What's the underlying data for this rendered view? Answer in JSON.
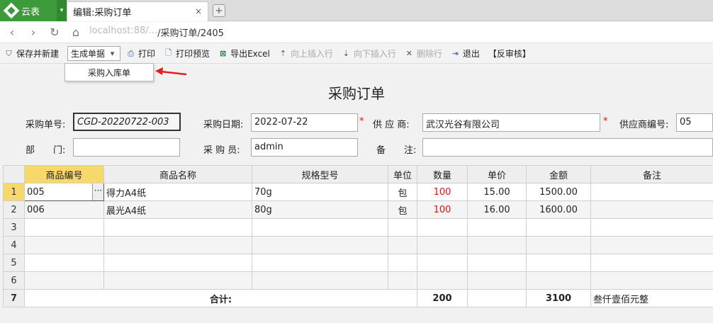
{
  "app": {
    "name": "云表"
  },
  "tab": {
    "title": "编辑:采购订单",
    "close": "×",
    "new_tab": "+"
  },
  "address": {
    "host": "localhost:88/...",
    "path": "/采购订单/2405"
  },
  "toolbar": {
    "save_new": "保存并新建",
    "generate": "生成单据",
    "print": "打印",
    "print_preview": "打印预览",
    "export_excel": "导出Excel",
    "insert_above": "向上插入行",
    "insert_below": "向下插入行",
    "delete_row": "删除行",
    "exit": "退出",
    "unreview": "【反审核】"
  },
  "menu": {
    "items": [
      "采购入库单"
    ]
  },
  "form": {
    "title": "采购订单",
    "order_no_label": "采购单号:",
    "order_no": "CGD-20220722-003",
    "date_label": "采购日期:",
    "date": "2022-07-22",
    "supplier_label": "供 应 商:",
    "supplier": "武汉光谷有限公司",
    "supplier_code_label": "供应商编号:",
    "supplier_code": "05",
    "dept_label": "部　　门:",
    "dept": "",
    "buyer_label": "采 购 员:",
    "buyer": "admin",
    "remark_label": "备　　注:",
    "remark": "",
    "required_mark": "*"
  },
  "grid": {
    "columns": [
      "商品编号",
      "商品名称",
      "规格型号",
      "单位",
      "数量",
      "单价",
      "金额",
      "备注"
    ],
    "rows": [
      {
        "n": "1",
        "code": "005",
        "name": "得力A4纸",
        "spec": "70g",
        "unit": "包",
        "qty": "100",
        "price": "15.00",
        "amount": "1500.00",
        "note": ""
      },
      {
        "n": "2",
        "code": "006",
        "name": "晨光A4纸",
        "spec": "80g",
        "unit": "包",
        "qty": "100",
        "price": "16.00",
        "amount": "1600.00",
        "note": ""
      }
    ],
    "empty_rows": [
      "3",
      "4",
      "5",
      "6"
    ],
    "total": {
      "n": "7",
      "label": "合计:",
      "qty": "200",
      "amount": "3100",
      "note": "叁仟壹佰元整"
    }
  },
  "colors": {
    "accent_green": "#3c9a3a",
    "selected_header": "#f7d96b",
    "qty_red": "#d11111"
  }
}
